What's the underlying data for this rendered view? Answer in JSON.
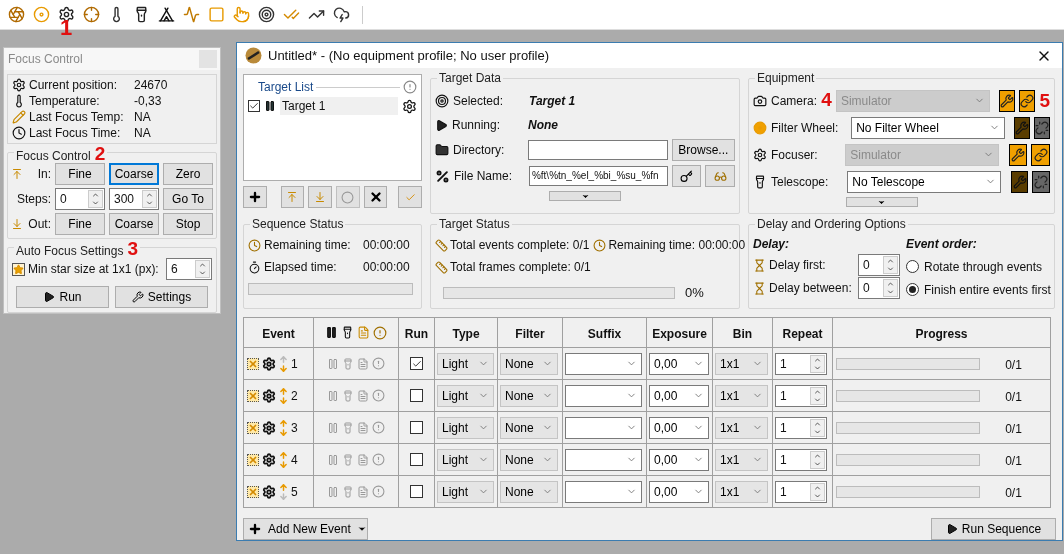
{
  "toolbar": {
    "callout": "1"
  },
  "focus_window": {
    "title": "Focus Control",
    "info": [
      {
        "label": "Current position:",
        "value": "24670"
      },
      {
        "label": "Temperature:",
        "value": "-0,33"
      },
      {
        "label": "Last Focus Temp:",
        "value": "NA"
      },
      {
        "label": "Last Focus Time:",
        "value": "NA"
      }
    ],
    "focus_control": {
      "title": "Focus Control",
      "callout": "2",
      "in_label": "In:",
      "in_buttons": [
        {
          "label": "Fine",
          "selected": false
        },
        {
          "label": "Coarse",
          "selected": true
        },
        {
          "label": "Zero",
          "selected": false
        }
      ],
      "steps_label": "Steps:",
      "steps": [
        "0",
        "300"
      ],
      "goto": "Go To",
      "out_label": "Out:",
      "out_buttons": [
        "Fine",
        "Coarse",
        "Stop"
      ]
    },
    "auto_focus": {
      "title": "Auto Focus Settings",
      "callout": "3",
      "min_star_label": "Min star size at 1x1 (px):",
      "min_star_value": "6",
      "run": "Run",
      "settings": "Settings"
    }
  },
  "main_window": {
    "title": "Untitled* - (No equipment profile; No user profile)",
    "target_list": {
      "title": "Target List",
      "items": [
        {
          "name": "Target 1",
          "checked": true
        }
      ]
    },
    "target_data": {
      "title": "Target Data",
      "selected_label": "Selected:",
      "selected_value": "Target 1",
      "running_label": "Running:",
      "running_value": "None",
      "directory_label": "Directory:",
      "browse": "Browse...",
      "file_name_label": "File Name:",
      "file_name_value": "%ft\\%tn_%el_%bi_%su_%fn"
    },
    "equipment": {
      "title": "Equipment",
      "callout": "5",
      "devices": [
        {
          "kind": "camera",
          "label": "Camera:",
          "value": "Simulator",
          "disabled": true,
          "connected": true,
          "callout": "4"
        },
        {
          "kind": "filter",
          "label": "Filter Wheel:",
          "value": "No Filter Wheel",
          "disabled": false,
          "connected": false
        },
        {
          "kind": "focuser",
          "label": "Focuser:",
          "value": "Simulator",
          "disabled": true,
          "connected": true
        },
        {
          "kind": "telescope",
          "label": "Telescope:",
          "value": "No Telescope",
          "disabled": false,
          "connected": false
        }
      ]
    },
    "sequence_status": {
      "title": "Sequence Status",
      "rows": [
        {
          "kind": "remaining",
          "label": "Remaining time:",
          "value": "00:00:00"
        },
        {
          "kind": "elapsed",
          "label": "Elapsed time:",
          "value": "00:00:00"
        }
      ],
      "level": 0
    },
    "target_status": {
      "title": "Target Status",
      "events_complete": "Total events complete: 0/1",
      "remaining": "Remaining time: 00:00:00",
      "frames_complete": "Total frames complete: 0/1",
      "level": 0,
      "percent": "0%"
    },
    "delay_options": {
      "title": "Delay and Ordering Options",
      "delay_heading": "Delay:",
      "delay_first_label": "Delay first:",
      "delay_first": "0",
      "delay_between_label": "Delay between:",
      "delay_between": "0",
      "order_heading": "Event order:",
      "order_options": [
        {
          "label": "Rotate through events",
          "selected": false
        },
        {
          "label": "Finish entire events first",
          "selected": true
        }
      ]
    },
    "events_table": {
      "columns": [
        "Event",
        "Run",
        "Type",
        "Filter",
        "Suffix",
        "Exposure",
        "Bin",
        "Repeat",
        "Progress"
      ],
      "rows": [
        {
          "number": "1",
          "can_move_up": false,
          "can_move_down": true,
          "run": true,
          "type": "Light",
          "filter": "None",
          "exposure": "0,00",
          "bin": "1x1",
          "repeat": "1",
          "level": 0,
          "progress": "0/1"
        },
        {
          "number": "2",
          "can_move_up": true,
          "can_move_down": true,
          "run": false,
          "type": "Light",
          "filter": "None",
          "exposure": "0,00",
          "bin": "1x1",
          "repeat": "1",
          "level": 0,
          "progress": "0/1"
        },
        {
          "number": "3",
          "can_move_up": true,
          "can_move_down": true,
          "run": false,
          "type": "Light",
          "filter": "None",
          "exposure": "0,00",
          "bin": "1x1",
          "repeat": "1",
          "level": 0,
          "progress": "0/1"
        },
        {
          "number": "4",
          "can_move_up": true,
          "can_move_down": true,
          "run": false,
          "type": "Light",
          "filter": "None",
          "exposure": "0,00",
          "bin": "1x1",
          "repeat": "1",
          "level": 0,
          "progress": "0/1"
        },
        {
          "number": "5",
          "can_move_up": true,
          "can_move_down": false,
          "run": false,
          "type": "Light",
          "filter": "None",
          "exposure": "0,00",
          "bin": "1x1",
          "repeat": "1",
          "level": 0,
          "progress": "0/1"
        }
      ]
    },
    "add_event": "Add New Event",
    "run_sequence": "Run Sequence"
  }
}
